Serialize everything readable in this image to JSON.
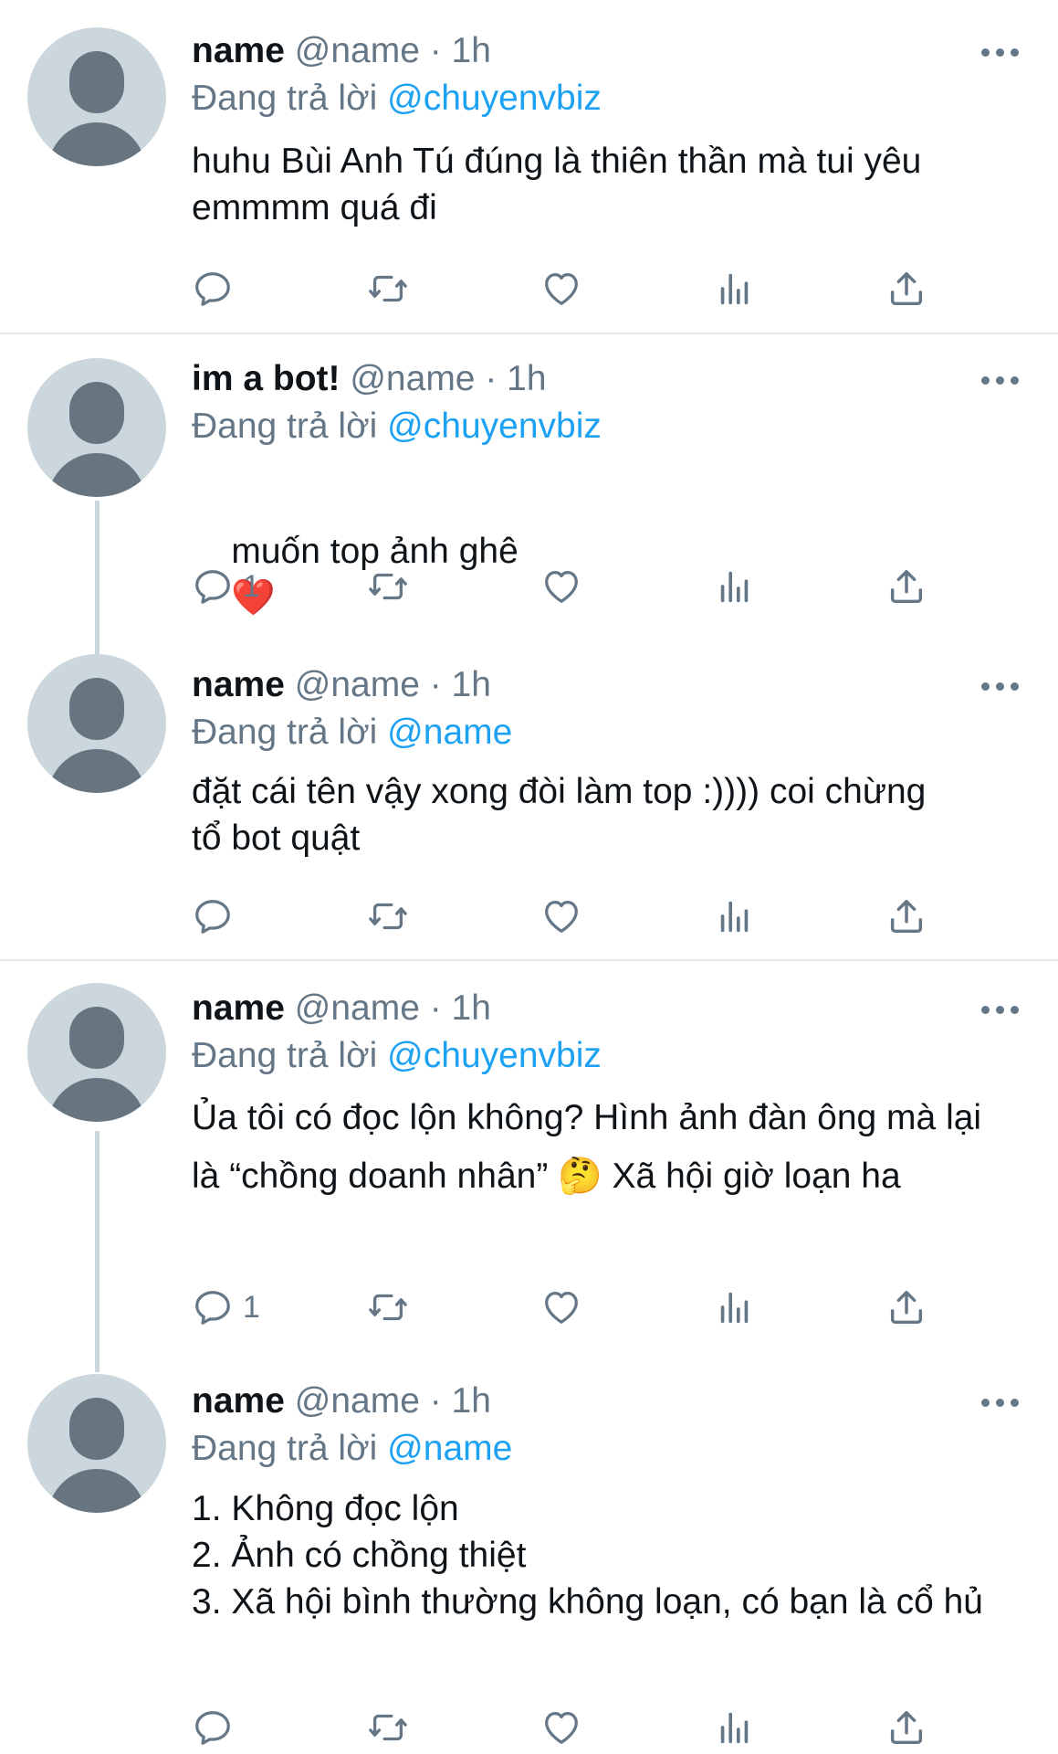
{
  "tweets": [
    {
      "display_name": "name",
      "handle": "@name",
      "time": "· 1h",
      "replying_label": "Đang trả lời",
      "replying_to": "@chuyenvbiz",
      "text": "huhu Bùi Anh Tú đúng là thiên thần mà tui yêu emmmm quá đi",
      "reply_count": ""
    },
    {
      "display_name": "im a bot!",
      "handle": "@name",
      "time": "· 1h",
      "replying_label": "Đang trả lời",
      "replying_to": "@chuyenvbiz",
      "text": "muốn top ảnh ghê",
      "emoji": "❤️",
      "reply_count": "1"
    },
    {
      "display_name": "name",
      "handle": "@name",
      "time": "· 1h",
      "replying_label": "Đang trả lời",
      "replying_to": "@name",
      "text": "đặt cái tên vậy xong đòi làm top :)))) coi chừng tổ bot quật",
      "reply_count": ""
    },
    {
      "display_name": "name",
      "handle": "@name",
      "time": "· 1h",
      "replying_label": "Đang trả lời",
      "replying_to": "@chuyenvbiz",
      "text": "Ủa tôi có đọc lộn không? Hình ảnh đàn ông mà lại là “chồng doanh nhân” 🤔 Xã hội giờ loạn ha",
      "reply_count": "1"
    },
    {
      "display_name": "name",
      "handle": "@name",
      "time": "· 1h",
      "replying_label": "Đang trả lời",
      "replying_to": "@name",
      "text": "1. Không đọc lộn\n2. Ảnh có chồng thiệt\n3. Xã hội bình thường không loạn, có bạn là cổ hủ",
      "reply_count": ""
    }
  ],
  "icons": {
    "reply": "reply-icon",
    "retweet": "retweet-icon",
    "like": "heart-icon",
    "analytics": "analytics-icon",
    "share": "share-icon",
    "more": "more-icon"
  },
  "colors": {
    "mention": "#1da1f2",
    "secondary_text": "#657786",
    "avatar_bg": "#ccd6dd",
    "avatar_fg": "#66757f",
    "divider": "#e1e8ed"
  }
}
